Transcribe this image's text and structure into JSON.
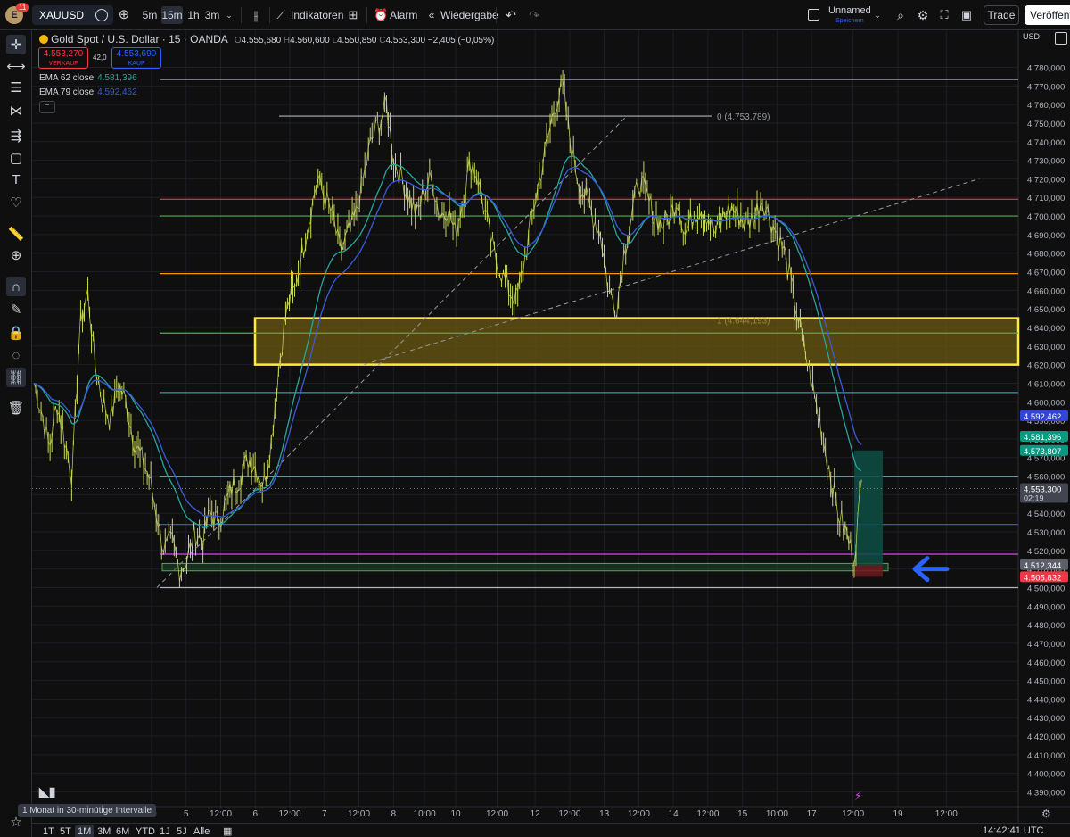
{
  "header": {
    "avatar_letter": "E",
    "badge_count": "11",
    "symbol": "XAUUSD",
    "intervals": [
      "5m",
      "15m",
      "1h",
      "3m"
    ],
    "active_interval": "15m",
    "indicators_label": "Indikatoren",
    "alarm_label": "Alarm",
    "replay_label": "Wiedergabe",
    "layout_name": "Unnamed",
    "layout_status": "Speichern",
    "trade_label": "Trade",
    "publish_label": "Veröffentl"
  },
  "legend": {
    "title": "Gold Spot / U.S. Dollar · 15 · OANDA",
    "open_label": "O",
    "open": "4.555,680",
    "high_label": "H",
    "high": "4.560,600",
    "low_label": "L",
    "low": "4.550,850",
    "close_label": "C",
    "close": "4.553,300",
    "change": "−2,405 (−0,05%)",
    "sell_price": "4.553,270",
    "sell_label": "VERKAUF",
    "spread": "42,0",
    "buy_price": "4.553,690",
    "buy_label": "KAUF",
    "ema1_label": "EMA 62 close",
    "ema1_value": "4.581,396",
    "ema2_label": "EMA 79 close",
    "ema2_value": "4.592,462",
    "collapse_icon": "chevron-up-icon"
  },
  "price_axis": {
    "currency": "USD",
    "ticks": [
      "4.780,000",
      "4.770,000",
      "4.760,000",
      "4.750,000",
      "4.740,000",
      "4.730,000",
      "4.720,000",
      "4.710,000",
      "4.700,000",
      "4.690,000",
      "4.680,000",
      "4.670,000",
      "4.660,000",
      "4.650,000",
      "4.640,000",
      "4.630,000",
      "4.620,000",
      "4.610,000",
      "4.600,000",
      "4.590,000",
      "4.580,000",
      "4.570,000",
      "4.560,000",
      "4.550,000",
      "4.540,000",
      "4.530,000",
      "4.520,000",
      "4.510,000",
      "4.500,000",
      "4.490,000",
      "4.480,000",
      "4.470,000",
      "4.460,000",
      "4.450,000",
      "4.440,000",
      "4.430,000",
      "4.420,000",
      "4.410,000",
      "4.400,000",
      "4.390,000"
    ],
    "labels": [
      {
        "value": 4592.462,
        "text": "4.592,462",
        "color": "#3344d9"
      },
      {
        "value": 4581.396,
        "text": "4.581,396",
        "color": "#089981"
      },
      {
        "value": 4573.807,
        "text": "4.573,807",
        "color": "#089981"
      },
      {
        "value": 4553.3,
        "text": "4.553,300",
        "sub": "02:19",
        "color": "#434651"
      },
      {
        "value": 4512.344,
        "text": "4.512,344",
        "color": "#5d606b"
      },
      {
        "value": 4505.832,
        "text": "4.505,832",
        "color": "#f23645"
      }
    ]
  },
  "time_axis": {
    "labels": [
      {
        "text": "00",
        "bar": 0
      },
      {
        "text": "5",
        "bar": 5
      },
      {
        "text": "12:00",
        "bar": 10
      },
      {
        "text": "6",
        "bar": 15
      },
      {
        "text": "12:00",
        "bar": 20
      },
      {
        "text": "7",
        "bar": 25
      },
      {
        "text": "12:00",
        "bar": 30
      },
      {
        "text": "8",
        "bar": 35
      },
      {
        "text": "10:00",
        "bar": 39.5
      },
      {
        "text": "10",
        "bar": 44
      },
      {
        "text": "12:00",
        "bar": 50
      },
      {
        "text": "12",
        "bar": 55.5
      },
      {
        "text": "12:00",
        "bar": 60.5
      },
      {
        "text": "13",
        "bar": 65.5
      },
      {
        "text": "12:00",
        "bar": 70.5
      },
      {
        "text": "14",
        "bar": 75.5
      },
      {
        "text": "12:00",
        "bar": 80.5
      },
      {
        "text": "15",
        "bar": 85.5
      },
      {
        "text": "10:00",
        "bar": 90.5
      },
      {
        "text": "17",
        "bar": 95.5
      },
      {
        "text": "12:00",
        "bar": 101.5
      },
      {
        "text": "19",
        "bar": 108
      },
      {
        "text": "12:00",
        "bar": 115
      }
    ]
  },
  "bottom": {
    "ranges": [
      "1T",
      "5T",
      "1M",
      "3M",
      "6M",
      "YTD",
      "1J",
      "5J",
      "Alle"
    ],
    "active_range": "1M",
    "tooltip": "1 Monat in 30-minütige Intervalle",
    "clock": "14:42:41 UTC"
  },
  "annotations": {
    "fib_top_label": "0 (4.753,789)",
    "fib_mid_label": "0,5 (4.700,...)",
    "fib_low_label": "1 (4.644,193)"
  },
  "colors": {
    "background": "#0f0f0f",
    "candles": "#c8d65a",
    "ema62": "#26a69a",
    "ema79": "#3a5bd9",
    "zone_fill": "#6b5a12",
    "zone_border": "#ffeb3b",
    "arrow": "#2962ff"
  },
  "chart_data": {
    "type": "line",
    "title": "Gold Spot / U.S. Dollar · 15 · OANDA",
    "symbol": "XAUUSD",
    "interval": "15",
    "ylim": [
      4385,
      4785
    ],
    "series": [
      {
        "name": "EMA 62 close",
        "last": 4581.396
      },
      {
        "name": "EMA 79 close",
        "last": 4592.462
      }
    ],
    "price_path": [
      4610,
      4595,
      4575,
      4600,
      4580,
      4560,
      4640,
      4660,
      4620,
      4600,
      4590,
      4610,
      4600,
      4580,
      4570,
      4560,
      4540,
      4520,
      4525,
      4510,
      4515,
      4530,
      4525,
      4540,
      4535,
      4545,
      4555,
      4560,
      4570,
      4565,
      4555,
      4580,
      4620,
      4650,
      4660,
      4680,
      4700,
      4720,
      4710,
      4700,
      4680,
      4690,
      4700,
      4720,
      4740,
      4750,
      4760,
      4730,
      4720,
      4710,
      4700,
      4715,
      4720,
      4700,
      4705,
      4690,
      4710,
      4730,
      4720,
      4700,
      4680,
      4670,
      4660,
      4655,
      4675,
      4700,
      4720,
      4740,
      4760,
      4770,
      4740,
      4720,
      4710,
      4700,
      4690,
      4660,
      4650,
      4680,
      4700,
      4720,
      4710,
      4700,
      4695,
      4700,
      4710,
      4690,
      4700,
      4705,
      4700,
      4690,
      4700,
      4705,
      4700,
      4695,
      4700,
      4710,
      4700,
      4690,
      4680,
      4660,
      4640,
      4620,
      4600,
      4580,
      4560,
      4540,
      4530,
      4515,
      4555
    ],
    "horizontal_levels": [
      {
        "value": 4773.5,
        "color": "#b2b5be"
      },
      {
        "value": 4753.789,
        "color": "#b2b5be"
      },
      {
        "value": 4709,
        "color": "#f23645"
      },
      {
        "value": 4700,
        "color": "#4caf50"
      },
      {
        "value": 4669,
        "color": "#ff9800"
      },
      {
        "value": 4637,
        "color": "#4caf50"
      },
      {
        "value": 4605,
        "color": "#26a69a"
      },
      {
        "value": 4560,
        "color": "#00bcd4"
      },
      {
        "value": 4534,
        "color": "#2962ff"
      },
      {
        "value": 4518,
        "color": "#e040fb"
      },
      {
        "value": 4500,
        "color": "#b2b5be"
      }
    ],
    "zone": {
      "from": 4620,
      "to": 4645
    },
    "trendlines": [
      {
        "from_bar": 0,
        "from_price": 4500,
        "to_bar": 68,
        "to_price": 4753.789
      },
      {
        "from_bar": 30,
        "from_price": 4620,
        "to_bar": 119,
        "to_price": 4720
      }
    ],
    "position_box": {
      "entry": 4512.344,
      "target": 4573.807,
      "stop": 4505.832
    }
  }
}
